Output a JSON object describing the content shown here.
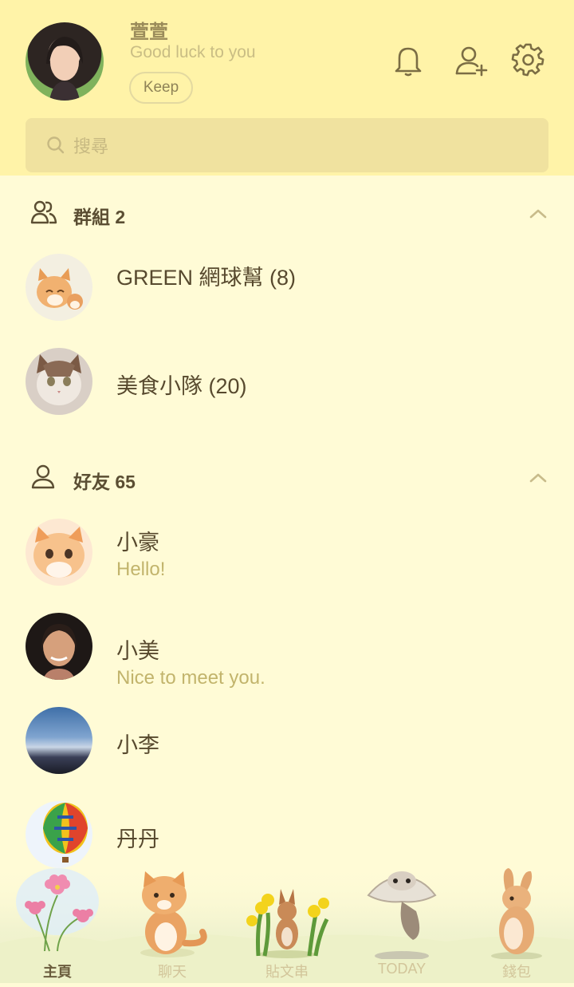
{
  "profile": {
    "name": "萱萱",
    "status": "Good luck to you",
    "keep_label": "Keep"
  },
  "header_icons": [
    "bell-icon",
    "add-friend-icon",
    "settings-icon"
  ],
  "search": {
    "placeholder": "搜尋"
  },
  "groups": {
    "title": "群組 2",
    "items": [
      {
        "name": "GREEN 網球幫 (8)"
      },
      {
        "name": "美食小隊 (20)"
      }
    ]
  },
  "friends": {
    "title": "好友 65",
    "items": [
      {
        "name": "小豪",
        "status": "Hello!"
      },
      {
        "name": "小美",
        "status": "Nice to meet you."
      },
      {
        "name": "小李",
        "status": ""
      },
      {
        "name": "丹丹",
        "status": ""
      }
    ]
  },
  "tabs": [
    {
      "label": "主頁",
      "active": true
    },
    {
      "label": "聊天",
      "active": false
    },
    {
      "label": "貼文串",
      "active": false
    },
    {
      "label": "TODAY",
      "active": false
    },
    {
      "label": "錢包",
      "active": false
    }
  ],
  "colors": {
    "header_bg": "#fff3a8",
    "body_bg": "#fffbd6",
    "search_bg": "#f0e29f",
    "text": "#57492e",
    "muted": "#c2b46c"
  }
}
